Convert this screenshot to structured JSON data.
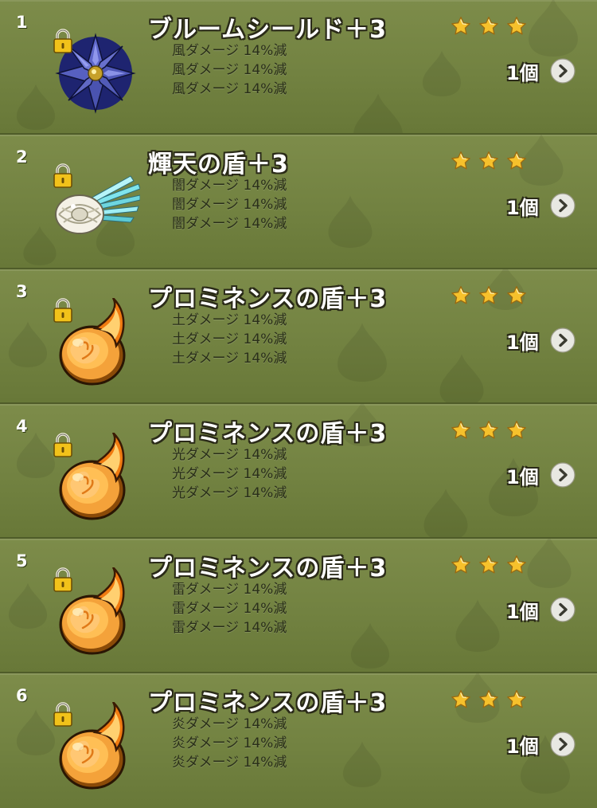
{
  "colors": {
    "panel_bg": "#728241",
    "divider": "#4f5c29",
    "star": "#f6c12c",
    "chevron_bg": "#e8e8e2",
    "chevron_fg": "#3a3a30"
  },
  "items": [
    {
      "index": "1",
      "name": "ブルームシールド＋3",
      "icon": "bloom-shield-icon",
      "effects": [
        "風ダメージ 14%減",
        "風ダメージ 14%減",
        "風ダメージ 14%減"
      ],
      "stars": 3,
      "count": "1個"
    },
    {
      "index": "2",
      "name": "輝天の盾＋3",
      "icon": "kiten-shield-icon",
      "effects": [
        "闇ダメージ 14%減",
        "闇ダメージ 14%減",
        "闇ダメージ 14%減"
      ],
      "stars": 3,
      "count": "1個"
    },
    {
      "index": "3",
      "name": "プロミネンスの盾＋3",
      "icon": "prominence-shield-icon",
      "effects": [
        "土ダメージ 14%減",
        "土ダメージ 14%減",
        "土ダメージ 14%減"
      ],
      "stars": 3,
      "count": "1個"
    },
    {
      "index": "4",
      "name": "プロミネンスの盾＋3",
      "icon": "prominence-shield-icon",
      "effects": [
        "光ダメージ 14%減",
        "光ダメージ 14%減",
        "光ダメージ 14%減"
      ],
      "stars": 3,
      "count": "1個"
    },
    {
      "index": "5",
      "name": "プロミネンスの盾＋3",
      "icon": "prominence-shield-icon",
      "effects": [
        "雷ダメージ 14%減",
        "雷ダメージ 14%減",
        "雷ダメージ 14%減"
      ],
      "stars": 3,
      "count": "1個"
    },
    {
      "index": "6",
      "name": "プロミネンスの盾＋3",
      "icon": "prominence-shield-icon",
      "effects": [
        "炎ダメージ 14%減",
        "炎ダメージ 14%減",
        "炎ダメージ 14%減"
      ],
      "stars": 3,
      "count": "1個"
    }
  ]
}
